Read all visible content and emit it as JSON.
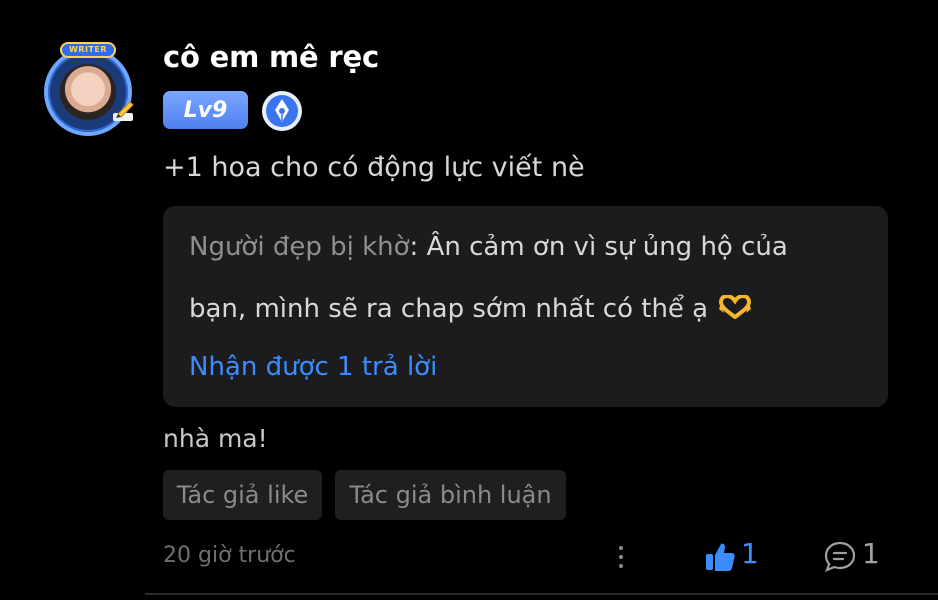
{
  "user": {
    "name": "cô em mê rẹc",
    "avatar_badge": "WRITER",
    "level": "Lv9"
  },
  "comment": {
    "text": "+1 hoa cho có động lực viết nè",
    "reply": {
      "author": "Người đẹp bị khờ",
      "separator": ": ",
      "line1": "Ân cảm ơn vì sự ủng hộ của",
      "line2": "bạn, mình sẽ ra chap sớm nhất có thể ạ",
      "received_link": "Nhận được 1 trả lời"
    },
    "second_text": "nhà ma!",
    "tags": [
      "Tác giả like",
      "Tác giả bình luận"
    ],
    "time": "20 giờ trước",
    "likes": "1",
    "replies": "1"
  },
  "colors": {
    "background": "#000000",
    "accent_blue": "#3b8cff",
    "level_badge": "#5b8cf5",
    "reply_box": "#1c1c1e"
  },
  "icons": {
    "writer": "writer-pen-icon",
    "like": "thumbs-up-icon",
    "comment": "comment-bubble-icon",
    "more": "more-vertical-icon",
    "emoji": "heart-hands-icon"
  }
}
